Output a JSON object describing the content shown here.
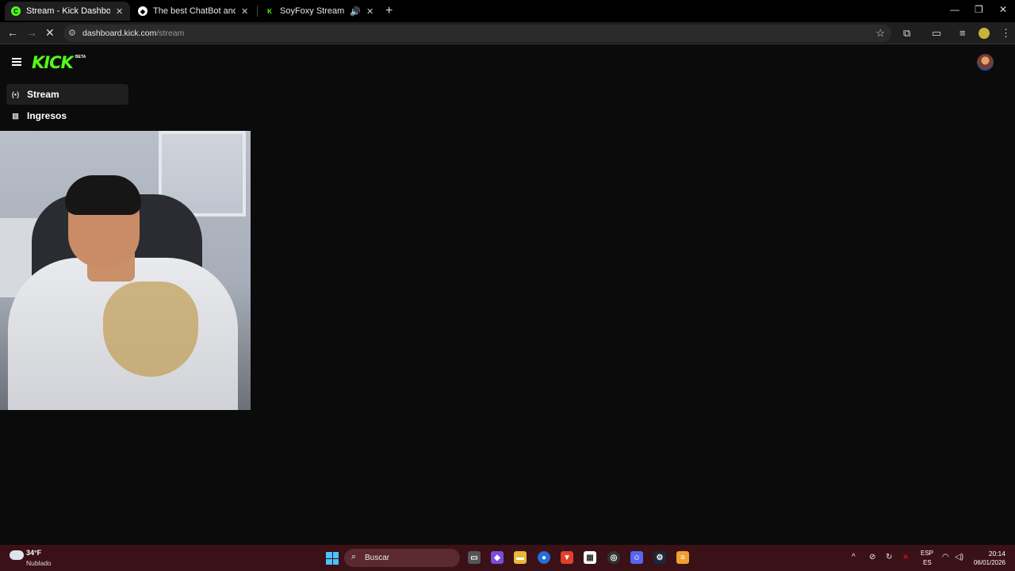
{
  "browser": {
    "tabs": [
      {
        "title": "Stream - Kick Dashboard",
        "active": true
      },
      {
        "title": "The best ChatBot and Widgets",
        "active": false
      },
      {
        "title": "SoyFoxy Stream - Watch Li",
        "active": false
      }
    ],
    "new_tab": "+",
    "window_controls": {
      "minimize": "—",
      "restore": "❐",
      "close": "✕"
    },
    "url_host": "dashboard.kick.com",
    "url_path": "/stream"
  },
  "page": {
    "logo": "KICK",
    "logo_badge": "BETA",
    "nav": [
      {
        "label": "Stream",
        "icon": "broadcast-icon"
      },
      {
        "label": "Ingresos",
        "icon": "chart-icon"
      }
    ]
  },
  "taskbar": {
    "weather_temp": "34°F",
    "weather_desc": "Nublado",
    "search_placeholder": "Buscar",
    "lang_top": "ESP",
    "lang_bottom": "ES",
    "time": "20:14",
    "date": "06/01/2026"
  },
  "colors": {
    "kick_green": "#53fc18",
    "page_bg": "#0b0b0b",
    "taskbar_bg": "#3a1116"
  }
}
